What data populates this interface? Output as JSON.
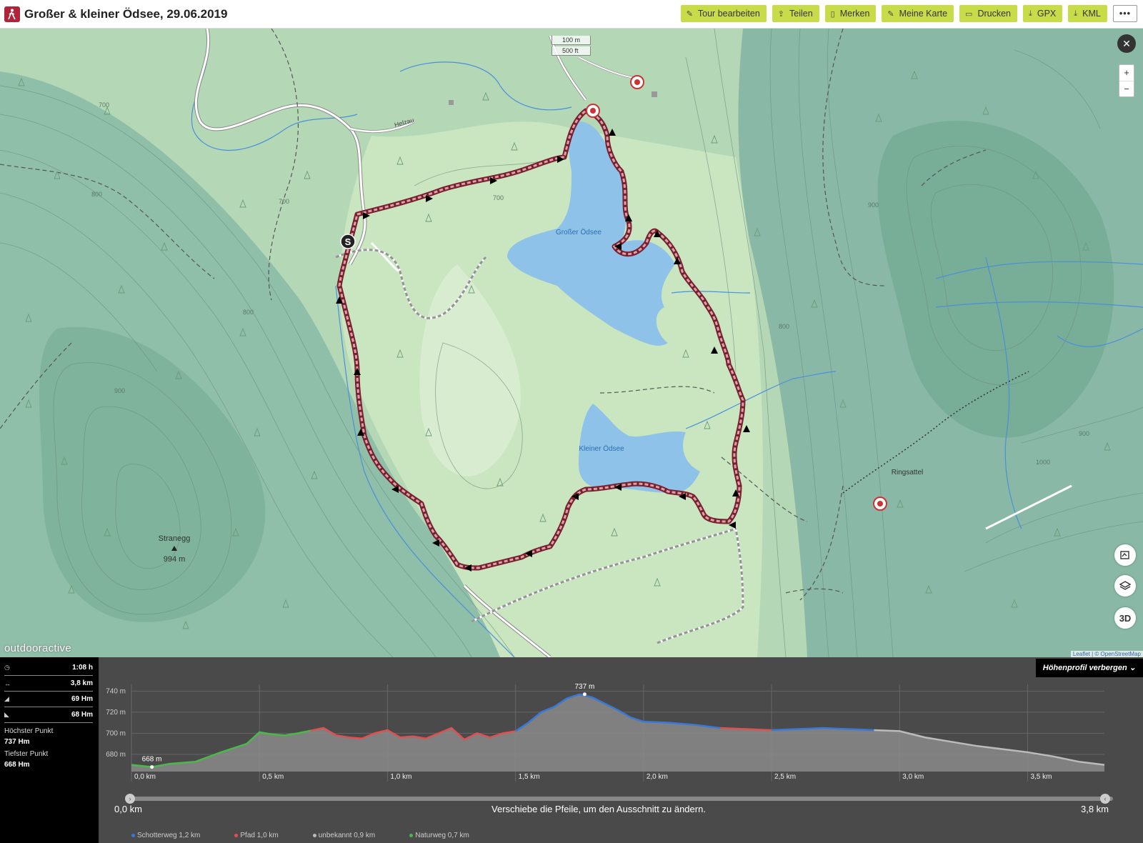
{
  "header": {
    "title": "Großer & kleiner Ödsee, 29.06.2019",
    "buttons": [
      {
        "label": "Tour bearbeiten",
        "icon": "edit-icon"
      },
      {
        "label": "Teilen",
        "icon": "share-icon"
      },
      {
        "label": "Merken",
        "icon": "bookmark-icon"
      },
      {
        "label": "Meine Karte",
        "icon": "my-map-icon"
      },
      {
        "label": "Drucken",
        "icon": "print-icon"
      },
      {
        "label": "GPX",
        "icon": "download-icon"
      },
      {
        "label": "KML",
        "icon": "download-icon"
      }
    ],
    "more_label": "•••"
  },
  "map": {
    "scale": {
      "metric": "100 m",
      "imperial": "500 ft"
    },
    "labels": {
      "lake_big": "Großer Ödsee",
      "lake_small": "Kleiner Ödsee",
      "road": "Helzau",
      "peak_name": "Stranegg",
      "peak_elev": "994 m",
      "pass": "Ringsattel",
      "start_marker": "S"
    },
    "contour_labels": [
      "700",
      "800",
      "900",
      "800",
      "700",
      "700",
      "800",
      "900",
      "1000",
      "900"
    ],
    "zoom_in": "+",
    "zoom_out": "−",
    "close": "✕",
    "btn_3d": "3D",
    "logo": "outdooractive",
    "attribution": "Leaflet | © OpenStreetMap"
  },
  "stats": {
    "rows": [
      {
        "icon": "clock-icon",
        "icon_glyph": "◷",
        "value": "1:08 h"
      },
      {
        "icon": "distance-icon",
        "icon_glyph": "↔",
        "value": "3,8 km"
      },
      {
        "icon": "ascent-icon",
        "icon_glyph": "◢",
        "value": "69 Hm"
      },
      {
        "icon": "descent-icon",
        "icon_glyph": "◣",
        "value": "68 Hm"
      }
    ],
    "highest_label": "Höchster Punkt",
    "highest_value": "737 Hm",
    "lowest_label": "Tiefster Punkt",
    "lowest_value": "668 Hm"
  },
  "profile": {
    "hide_label": "Höhenprofil verbergen",
    "range_start": "0,0 km",
    "range_end": "3,8 km",
    "hint": "Verschiebe die Pfeile, um den Ausschnitt zu ändern.",
    "legend": [
      {
        "label": "Schotterweg 1,2 km",
        "color": "#3a78d8"
      },
      {
        "label": "Pfad 1,0 km",
        "color": "#e05050"
      },
      {
        "label": "unbekannt 0,9 km",
        "color": "#bbbbbb"
      },
      {
        "label": "Naturweg 0,7 km",
        "color": "#4cb84c"
      }
    ]
  },
  "chart_data": {
    "type": "area",
    "xlabel": "",
    "ylabel": "",
    "xlim": [
      0,
      3.8
    ],
    "ylim": [
      665,
      745
    ],
    "x_ticks": [
      "0,0 km",
      "0,5 km",
      "1,0 km",
      "1,5 km",
      "2,0 km",
      "2,5 km",
      "3,0 km",
      "3,5 km"
    ],
    "y_ticks": [
      "680 m",
      "700 m",
      "720 m",
      "740 m"
    ],
    "annotations": [
      {
        "x": 0.08,
        "y": 668,
        "label": "668 m"
      },
      {
        "x": 1.77,
        "y": 737,
        "label": "737 m"
      }
    ],
    "x": [
      0.0,
      0.08,
      0.15,
      0.25,
      0.35,
      0.45,
      0.5,
      0.55,
      0.6,
      0.65,
      0.75,
      0.8,
      0.85,
      0.9,
      0.95,
      1.0,
      1.05,
      1.1,
      1.15,
      1.2,
      1.25,
      1.3,
      1.35,
      1.4,
      1.45,
      1.5,
      1.55,
      1.6,
      1.65,
      1.7,
      1.75,
      1.8,
      1.85,
      1.9,
      1.95,
      2.0,
      2.1,
      2.2,
      2.3,
      2.4,
      2.5,
      2.6,
      2.7,
      2.8,
      2.9,
      3.0,
      3.1,
      3.2,
      3.3,
      3.4,
      3.5,
      3.6,
      3.7,
      3.8
    ],
    "y": [
      670,
      668,
      671,
      673,
      682,
      690,
      701,
      699,
      698,
      700,
      705,
      698,
      696,
      695,
      700,
      703,
      696,
      697,
      695,
      700,
      705,
      694,
      700,
      696,
      700,
      702,
      710,
      720,
      725,
      733,
      737,
      734,
      728,
      722,
      715,
      711,
      710,
      708,
      705,
      704,
      703,
      704,
      705,
      704,
      703,
      702,
      696,
      692,
      688,
      685,
      682,
      678,
      673,
      670
    ],
    "segments": [
      {
        "name": "Naturweg",
        "from": 0.0,
        "to": 0.7
      },
      {
        "name": "Pfad",
        "from": 0.7,
        "to": 1.5
      },
      {
        "name": "Schotterweg",
        "from": 1.5,
        "to": 2.3
      },
      {
        "name": "Pfad",
        "from": 2.3,
        "to": 2.5
      },
      {
        "name": "Schotterweg",
        "from": 2.5,
        "to": 2.9
      },
      {
        "name": "unbekannt",
        "from": 2.9,
        "to": 3.8
      }
    ],
    "segment_colors": {
      "Naturweg": "#4cb84c",
      "Pfad": "#e05050",
      "Schotterweg": "#3a78d8",
      "unbekannt": "#bbbbbb"
    },
    "grid": true
  }
}
